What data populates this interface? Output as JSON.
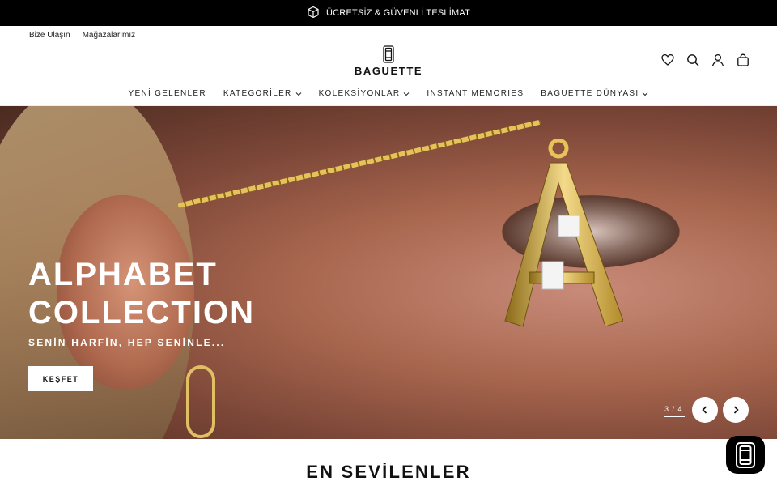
{
  "announcement": {
    "text": "ÜCRETSİZ & GÜVENLİ TESLİMAT",
    "icon": "box-icon"
  },
  "header": {
    "util_links": [
      "Bize Ulaşın",
      "Mağazalarımız"
    ],
    "brand": "BAGUETTE",
    "icons": [
      "heart-icon",
      "search-icon",
      "user-icon",
      "bag-icon"
    ]
  },
  "nav": {
    "items": [
      {
        "label": "YENİ GELENLER",
        "dropdown": false
      },
      {
        "label": "KATEGORİLER",
        "dropdown": true
      },
      {
        "label": "KOLEKSİYONLAR",
        "dropdown": true
      },
      {
        "label": "INSTANT MEMORIES",
        "dropdown": false
      },
      {
        "label": "BAGUETTE DÜNYASI",
        "dropdown": true
      }
    ]
  },
  "hero": {
    "title": "ALPHABET\nCOLLECTION",
    "subtitle": "SENİN HARFİN, HEP SENİNLE...",
    "cta": "KEŞFET",
    "counter": "3 / 4"
  },
  "section": {
    "title": "EN SEVİLENLER"
  },
  "colors": {
    "announcement_bg": "#000000",
    "accent_gold": "#e6c35a"
  }
}
